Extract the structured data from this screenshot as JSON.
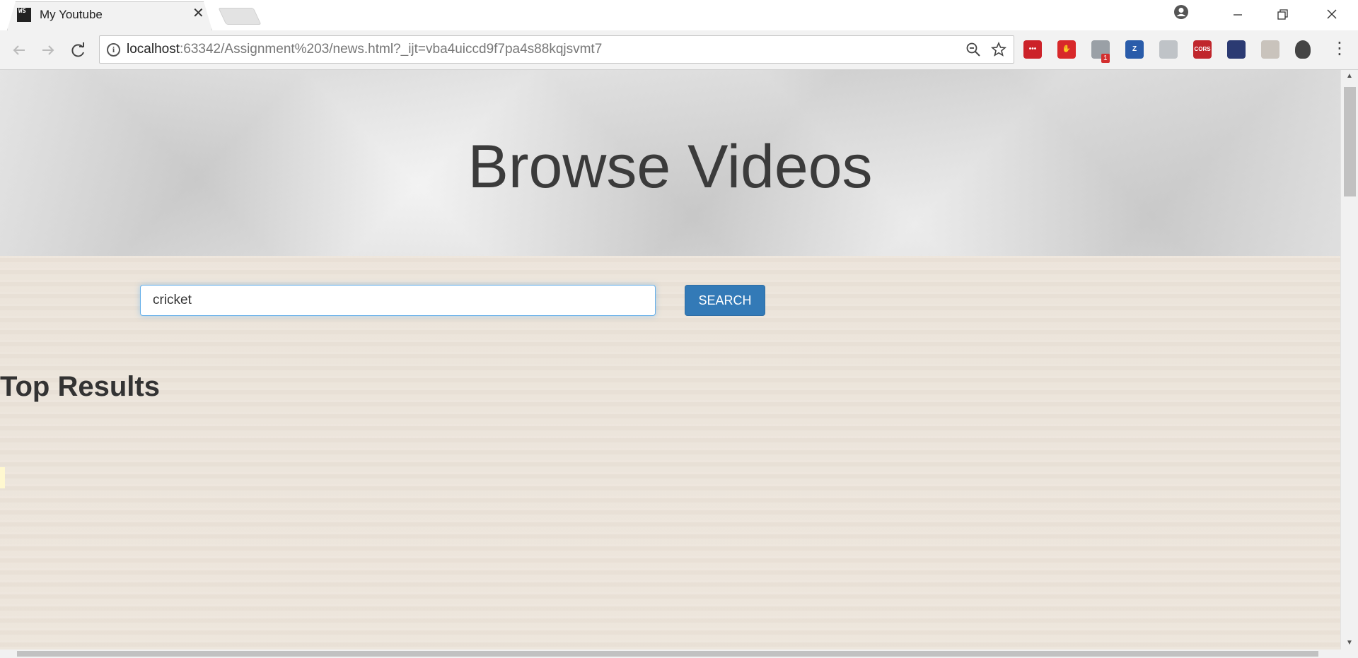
{
  "browser": {
    "tab_title": "My Youtube",
    "favicon_text": "WS",
    "close_glyph": "✕",
    "url_host": "localhost",
    "url_rest": ":63342/Assignment%203/news.html?_ijt=vba4uiccd9f7pa4s88kqjsvmt7",
    "extension_badge": "1",
    "extensions": [
      {
        "name": "lastpass-extension-icon",
        "label": "•••",
        "color": "#cc2229"
      },
      {
        "name": "adblock-extension-icon",
        "label": "✋",
        "color": "#d8282a"
      },
      {
        "name": "shield-badge-extension-icon",
        "label": "",
        "color": "#9aa0a6"
      },
      {
        "name": "zotero-extension-icon",
        "label": "Z",
        "color": "#2a5caa"
      },
      {
        "name": "swirl-extension-icon",
        "label": "",
        "color": "#bfc3c7"
      },
      {
        "name": "cors-extension-icon",
        "label": "CORS",
        "color": "#c0262c"
      },
      {
        "name": "dark-flag-extension-icon",
        "label": "",
        "color": "#2b3a72"
      },
      {
        "name": "grey-extension-icon",
        "label": "",
        "color": "#c9c3bc"
      },
      {
        "name": "privacy-shield-extension-icon",
        "label": "",
        "color": "#444444"
      }
    ]
  },
  "page": {
    "hero_title": "Browse Videos",
    "search_value": "cricket",
    "search_button_label": "SEARCH",
    "results_heading": "Top Results"
  },
  "colors": {
    "accent": "#337ab7",
    "focus_ring": "#66afe9"
  }
}
